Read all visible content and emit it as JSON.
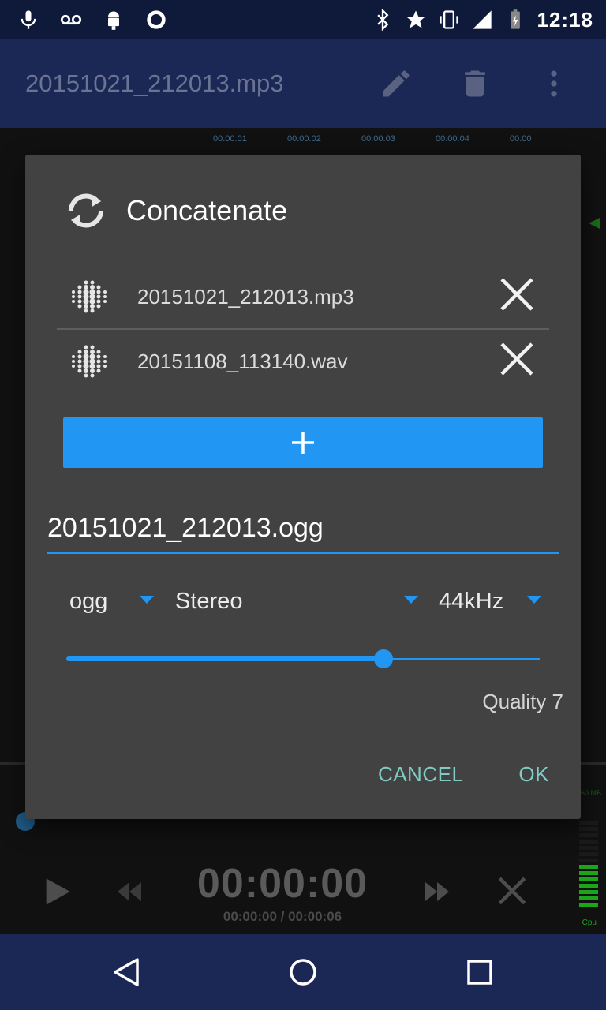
{
  "status_bar": {
    "time": "12:18",
    "left_icons": [
      "microphone-icon",
      "voicemail-icon",
      "android-icon",
      "circle-app-icon"
    ],
    "right_icons": [
      "bluetooth-icon",
      "star-icon",
      "vibrate-icon",
      "signal-icon",
      "battery-icon"
    ]
  },
  "app_bar": {
    "title": "20151021_212013.mp3",
    "actions": [
      "edit-icon",
      "delete-icon",
      "more-vert-icon"
    ]
  },
  "timeline": {
    "ticks": [
      "00:00:01",
      "00:00:02",
      "00:00:03",
      "00:00:04",
      "00:00"
    ]
  },
  "dialog": {
    "title": "Concatenate",
    "files": [
      {
        "name": "20151021_212013.mp3"
      },
      {
        "name": "20151108_113140.wav"
      }
    ],
    "output_filename": "20151021_212013.ogg",
    "format": "ogg",
    "channels": "Stereo",
    "sample_rate": "44kHz",
    "quality_label": "Quality 7",
    "quality_fraction": 0.67,
    "cancel_label": "CANCEL",
    "ok_label": "OK"
  },
  "player": {
    "current_time": "00:00:00",
    "position_duration": "00:00:00 / 00:00:06",
    "meter_top_label": "60 MB",
    "meter_bottom_label": "Cpu"
  },
  "colors": {
    "accent": "#2196f3",
    "dialog_bg": "#424242",
    "app_bar": "#1b2755",
    "button_text": "#80cbc4"
  }
}
